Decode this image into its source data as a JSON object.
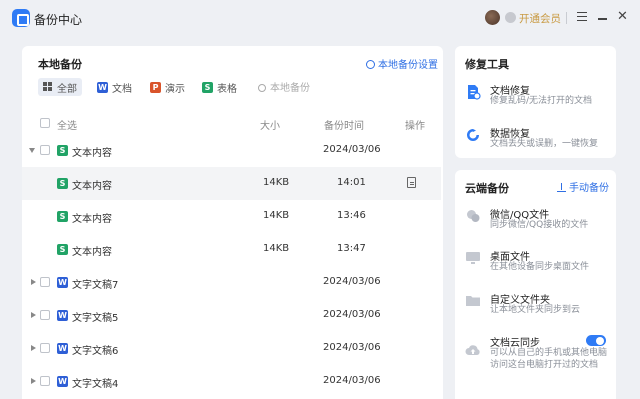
{
  "app": {
    "title": "备份中心"
  },
  "header": {
    "vip_label": "开通会员"
  },
  "local": {
    "title": "本地备份",
    "settings_label": "本地备份设置",
    "filters": {
      "all": "全部",
      "doc": "文档",
      "ppt": "演示",
      "sheet": "表格"
    },
    "search_placeholder": "本地备份",
    "columns": {
      "select_all": "全选",
      "size": "大小",
      "time": "备份时间",
      "action": "操作"
    },
    "rows": [
      {
        "type": "S",
        "name": "文本内容",
        "size": "",
        "time": "2024/03/06"
      },
      {
        "type": "S",
        "name": "文本内容",
        "size": "14KB",
        "time": "14:01"
      },
      {
        "type": "S",
        "name": "文本内容",
        "size": "14KB",
        "time": "13:46"
      },
      {
        "type": "S",
        "name": "文本内容",
        "size": "14KB",
        "time": "13:47"
      },
      {
        "type": "W",
        "name": "文字文稿7",
        "size": "",
        "time": "2024/03/06"
      },
      {
        "type": "W",
        "name": "文字文稿5",
        "size": "",
        "time": "2024/03/06"
      },
      {
        "type": "W",
        "name": "文字文稿6",
        "size": "",
        "time": "2024/03/06"
      },
      {
        "type": "W",
        "name": "文字文稿4",
        "size": "",
        "time": "2024/03/06"
      }
    ]
  },
  "repair": {
    "title": "修复工具",
    "tools": [
      {
        "title": "文档修复",
        "desc": "修复乱码/无法打开的文档"
      },
      {
        "title": "数据恢复",
        "desc": "文档丢失或误删，一键恢复"
      }
    ]
  },
  "cloud": {
    "title": "云端备份",
    "manual_label": "手动备份",
    "items": [
      {
        "title": "微信/QQ文件",
        "desc": "同步微信/QQ接收的文件"
      },
      {
        "title": "桌面文件",
        "desc": "在其他设备同步桌面文件"
      },
      {
        "title": "自定义文件夹",
        "desc": "让本地文件夹同步到云"
      },
      {
        "title": "文档云同步",
        "desc": "可以从自己的手机或其他电脑",
        "desc2": "访问这台电脑打开过的文档",
        "toggle_on": true
      }
    ]
  }
}
